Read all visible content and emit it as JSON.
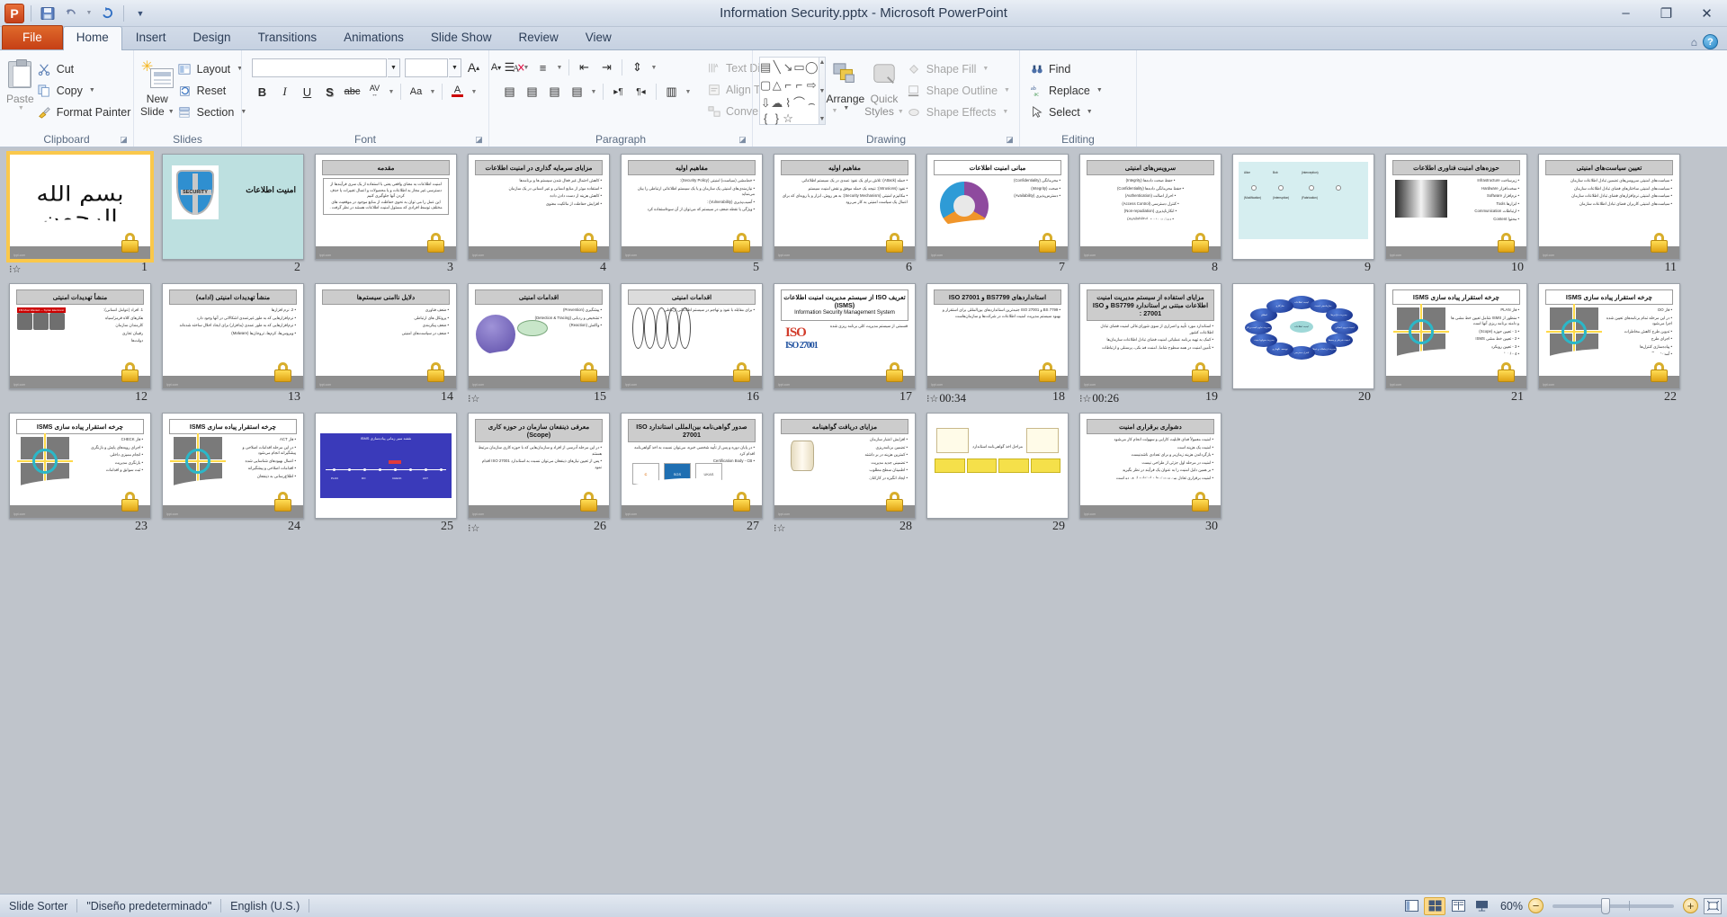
{
  "window": {
    "title": "Information Security.pptx  -  Microsoft PowerPoint",
    "minimize": "–",
    "restore": "❐",
    "close": "✕"
  },
  "qat": {
    "save": "save-icon",
    "undo": "undo-icon",
    "redo": "redo-icon",
    "customize": "customize-icon"
  },
  "tabs": [
    {
      "label": "File",
      "id": "file"
    },
    {
      "label": "Home",
      "id": "home"
    },
    {
      "label": "Insert",
      "id": "insert"
    },
    {
      "label": "Design",
      "id": "design"
    },
    {
      "label": "Transitions",
      "id": "transitions"
    },
    {
      "label": "Animations",
      "id": "animations"
    },
    {
      "label": "Slide Show",
      "id": "slideshow"
    },
    {
      "label": "Review",
      "id": "review"
    },
    {
      "label": "View",
      "id": "view"
    }
  ],
  "tab_active": "Home",
  "ribbon": {
    "clipboard": {
      "group_label": "Clipboard",
      "paste": "Paste",
      "cut": "Cut",
      "copy": "Copy",
      "format_painter": "Format Painter"
    },
    "slides": {
      "group_label": "Slides",
      "new_slide": "New",
      "new_slide2": "Slide",
      "layout": "Layout",
      "reset": "Reset",
      "section": "Section"
    },
    "font": {
      "group_label": "Font",
      "font_name": "",
      "font_size": "",
      "grow": "A",
      "shrink": "A",
      "clear_formatting": "clear-formatting-icon",
      "bold": "B",
      "italic": "I",
      "underline": "U",
      "shadow": "S",
      "strikethrough": "abc",
      "spacing": "AV",
      "case": "Aa",
      "color": "A"
    },
    "paragraph": {
      "group_label": "Paragraph",
      "text_direction": "Text Direction",
      "align_text": "Align Text",
      "convert_smartart": "Convert to SmartArt"
    },
    "drawing": {
      "group_label": "Drawing",
      "arrange": "Arrange",
      "quick_styles": "Quick",
      "quick_styles2": "Styles",
      "shape_fill": "Shape Fill",
      "shape_outline": "Shape Outline",
      "shape_effects": "Shape Effects",
      "shapes": [
        "▤",
        "╲",
        "↘",
        "▭",
        "◯",
        "▢",
        "△",
        "┐",
        "┘",
        "⇨",
        "⇩",
        "☁",
        "⌇",
        "⌒",
        "⌢",
        "{",
        "}",
        "☆"
      ]
    },
    "editing": {
      "group_label": "Editing",
      "find": "Find",
      "replace": "Replace",
      "select": "Select"
    }
  },
  "slides": [
    {
      "n": "1",
      "type": "bismillah",
      "title": "",
      "timing": "",
      "transition": true,
      "selected": true,
      "calligraphy": "بسم الله الرحمن الرحیم"
    },
    {
      "n": "2",
      "type": "teal",
      "title": "امنیت اطلاعات",
      "shield": "SECURITY",
      "timing": "",
      "transition": false
    },
    {
      "n": "3",
      "type": "textboxed",
      "title": "مقدمه",
      "timing": "",
      "transition": false,
      "lines": [
        "امنیت اطلاعات به معنای واقعی یعنی با استفاده از یک سری فرآیندها از دسترسی غیر مجاز به اطلاعات و یا محصولات و اعمال تغییرات یا حذف کردن آنها جلوگیری کنیم",
        "این عمل را می توان به نحوی حفاظت از منابع موجود در موقعیت های مختلف توسط افرادی که مسئول امنیت اطلاعات هستند در نظر گرفت ."
      ]
    },
    {
      "n": "4",
      "type": "bullets",
      "title": "مزایای سرمایه گذاری در امنیت اطلاعات",
      "timing": "",
      "transition": false,
      "lines": [
        "کاهش احتمال غیر فعال شدن سیستم ها و برنامه‌ها",
        "استفاده موثر از منابع انسانی و غیر انسانی در یک سازمان",
        "کاهش هزینه از دست دادن داده",
        "افزایش حفاظت از مالکیت معنوی"
      ]
    },
    {
      "n": "5",
      "type": "bullets",
      "title": "مفاهیم اولیه",
      "timing": "",
      "transition": false,
      "lines": [
        "خط‌مشی (سیاست) امنیتی (Security Policy):",
        "نیازمندی‌های امنیتی یک سازمان و یا یک سیستم اطلاعاتی ارتباطی را بیان می‌نماید",
        "آسیب‌پذیری (Vulnerability) :",
        "ویژگی یا نقطه ضعف در سیستم که می‌توان از آن سوءاستفاده کرد"
      ]
    },
    {
      "n": "6",
      "type": "bullets",
      "title": "مفاهیم اولیه",
      "timing": "",
      "transition": false,
      "lines": [
        "حمله (Attack): تلاش برای یک نفوذ عمدی در یک سیستم اطلاعاتی",
        "نفوذ (Intrusions): نتیجه یک حمله موفق و نقض امنیت سیستم",
        "مکانیزم امنیتی (Security Mechanism): به هر روش، ابزار و یا رویه‌ای که برای اعمال یک سیاست امنیتی به کار می‌رود"
      ]
    },
    {
      "n": "7",
      "type": "donut",
      "title": "مبانی امنیت اطلاعات",
      "timing": "",
      "transition": false,
      "lines": [
        "محرمانگی (Confidentiality)",
        "صحت (Integrity)",
        "دسترس‌پذیری (Availability)"
      ]
    },
    {
      "n": "8",
      "type": "bullets-center",
      "title": "سرویس‌های امنیتی",
      "timing": "",
      "transition": false,
      "lines": [
        "حفظ صحت داده‌ها (Integrity)",
        "حفظ محرمانگی داده‌ها (Confidentiality)",
        "احراز اصالت (Authentication)",
        "کنترل دسترسی (Access Control)",
        "انکارناپذیری (Non-repudiation)",
        "دسترس‌پذیری (Availability)"
      ]
    },
    {
      "n": "9",
      "type": "netdiag",
      "title": "",
      "timing": "",
      "transition": false,
      "lines": [
        "Alice",
        "Bob",
        "(interception)",
        "(Modification)",
        "(Interruption)",
        "(Fabrication)"
      ]
    },
    {
      "n": "10",
      "type": "server",
      "title": "حوزه‌های امنیت فناوری اطلاعات",
      "timing": "",
      "transition": false,
      "lines": [
        "زیرساخت Infrastructure",
        "سخت‌افزار Hardware",
        "نرم‌افزار Software",
        "ابزارها Tools",
        "ارتباطات Communication",
        "محتوا Content"
      ]
    },
    {
      "n": "11",
      "type": "bullets",
      "title": "تعیین سیاست‌های امنیتی",
      "timing": "",
      "transition": false,
      "lines": [
        "سیاست‌های امنیتی سرویس‌های تضمین تبادل اطلاعات سازمان",
        "سیاست‌های امنیتی ساختارهای فضای تبادل اطلاعات سازمان",
        "سیاست‌های امنیتی نرم‌افزارهای فضای تبادل اطلاعات سازمان",
        "سیاست‌های امنیتی کاربران فضای تبادل اطلاعات سازمان"
      ]
    },
    {
      "n": "12",
      "type": "photos",
      "title": "منشأ تهدیدات امنیتی",
      "timing": "",
      "transition": false,
      "banner": "FBI Most Wanted — Syrian Electronic Army",
      "lines": [
        "1. افراد (عوامل انسانی):",
        "هکرهای کلاه قرمز/سیاه",
        "کارمندان سازمان",
        "رقیبان تجاری",
        "دولت‌ها"
      ]
    },
    {
      "n": "13",
      "type": "bullets",
      "title": "منشأ تهدیدات امنیتی (ادامه)",
      "timing": "",
      "transition": false,
      "lines": [
        "2. نرم افزارها",
        "نرم‌افزارهایی که به طور غیرعمدی اشکالاتی در آنها وجود دارد",
        "نرم‌افزارهایی که به طور عمدی (بدافزار) برای ایجاد اخلال ساخته شده‌اند",
        "ویروس‌ها، کرم‌ها، تروجان‌ها (Malware)"
      ]
    },
    {
      "n": "14",
      "type": "bullets",
      "title": "دلایل ناامنی سیستم‌ها",
      "timing": "",
      "transition": false,
      "lines": [
        "ضعف فناوری",
        "پروتکل های ارتباطی",
        "ضعف پیکربندی",
        "ضعف در سیاست‌های امنیتی"
      ]
    },
    {
      "n": "15",
      "type": "cyclediag",
      "title": "اقدامات امنیتی",
      "timing": "",
      "transition": true,
      "lines": [
        "پیشگیری (Prevention)",
        "تشخیص و ردیابی (Detection & Tracing)",
        "واکنش (Reaction)"
      ]
    },
    {
      "n": "16",
      "type": "funnel",
      "title": "اقدامات امنیتی",
      "timing": "",
      "transition": false,
      "lines": [
        "برای مقابله با نفوذ و تهاجم در سیستم اطلاعاتی ارتباطی"
      ]
    },
    {
      "n": "17",
      "type": "iso",
      "title": "تعریف ISO از سیستم مدیریت امنیت اطلاعات (ISMS)",
      "subtitle": "Information  Security  Management  System",
      "timing": "",
      "transition": false,
      "lines": [
        "قسمتی از سیستم مدیریت کلی برنامه ریزی شده",
        "ISO 27001"
      ]
    },
    {
      "n": "18",
      "type": "bullets",
      "title": "استانداردهای BS7799 و ISO 27001",
      "timing": "00:34",
      "transition": true,
      "lines": [
        "BS 7799 و ISO 27001 جنبه‌ترین استانداردهای بین‌المللی برای استقرار و بهبود سیستم مدیریت امنیت اطلاعات در شرکت‌ها و سازمان‌هاست"
      ]
    },
    {
      "n": "19",
      "type": "bullets",
      "title": "مزایای استفاده از سیستم مدیریت امنیت اطلاعات مبتنی بر استاندارد BS7799 و ISO 27001 :",
      "timing": "00:26",
      "transition": true,
      "lines": [
        "استاندارد مورد تأیید و اصراری از سوی شورای‌عالی امنیت فضای تبادل اطلاعات کشور",
        "کمک به تهیه برنامه عملیاتی امنیت فضای تبادل اطلاعات سازمان‌ها",
        "تأمین امنیت در همه سطوح شامل امنیت فیزیکی، پرسنلی و ارتباطات"
      ]
    },
    {
      "n": "20",
      "type": "bluediag",
      "title": "",
      "timing": "",
      "transition": false,
      "lines": [
        "امنیت اطلاعات",
        "سازماندهی امنیت",
        "مدیریت دارایی‌ها",
        "امنیت نیروی انسانی",
        "امنیت فیزیکی و محیط",
        "مدیریت ارتباطات و عملیات",
        "کنترل دسترسی",
        "توسعه، نگهداری",
        "مدیریت سوانح امنیت",
        "مدیریت تداوم کسب و کار",
        "انطباق",
        "سازگاری"
      ]
    },
    {
      "n": "21",
      "type": "pdca",
      "title": "چرخه استقرار پیاده سازی ISMS",
      "timing": "",
      "transition": false,
      "lines": [
        "فاز PLAN",
        "منظور از ISMS شامل تعیین خط مشی ها و دامنه برنامه ریزی آنها است",
        "1 - تعیین حوزه (Scope)",
        "2 - تعیین خط مشی ISMS",
        "3 - تعیین رویکرد",
        "4 - ارزیابی ریسک",
        "5 - انتخاب کنترل‌های مناسب"
      ]
    },
    {
      "n": "22",
      "type": "pdca",
      "title": "چرخه استقرار پیاده سازی ISMS",
      "timing": "",
      "transition": false,
      "lines": [
        "فاز DO",
        "در این مرحله تمام برنامه‌های تعیین شده اجرا می‌شود",
        "تدوین طرح کاهش مخاطرات",
        "اجرای طرح",
        "پیاده‌سازی کنترل‌ها",
        "آموزش و آگاهی‌رسانی",
        "مدیریت عملیات"
      ]
    },
    {
      "n": "23",
      "type": "pdca",
      "title": "چرخه استقرار پیاده سازی ISMS",
      "timing": "",
      "transition": false,
      "lines": [
        "فاز CHECK",
        "اجرای رویه‌های پایش و بازنگری",
        "انجام ممیزی داخلی",
        "بازنگری مدیریت",
        "ثبت سوابق و اقدامات"
      ]
    },
    {
      "n": "24",
      "type": "pdca",
      "title": "چرخه استقرار پیاده سازی ISMS",
      "timing": "",
      "transition": false,
      "lines": [
        "فاز ACT",
        "در این مرحله اقدامات اصلاحی و پیشگیرانه انجام می‌شود",
        "اعمال بهبودهای شناسایی شده",
        "اقدامات اصلاحی و پیشگیرانه",
        "اطلاع‌رسانی به ذینفعان"
      ]
    },
    {
      "n": "25",
      "type": "blueline",
      "title": "نقشه سیر زمانی پیاده‌سازی ISMS",
      "timing": "",
      "transition": false,
      "lines": [
        "PLAN",
        "DO",
        "CHECK",
        "ACT"
      ]
    },
    {
      "n": "26",
      "type": "bullets",
      "title": "معرفی ذینفعان سازمان در حوزه کاری (Scope)",
      "timing": "",
      "transition": true,
      "lines": [
        "در این مرحله آدرسی از افراد و سازمان‌هایی که با حوزه کاری سازمان مرتبط هستند",
        "پس از تعیین نیازهای ذینفعان می‌توان نسبت به استاندارد ISO 27001 اقدام نمود"
      ]
    },
    {
      "n": "27",
      "type": "certs",
      "title": "صدور گواهی‌نامه بین‌المللی استاندارد ISO 27001",
      "timing": "",
      "transition": false,
      "lines": [
        "در پایان دوره و پس از تأیید شخصی خبره، می‌توان نسبت به اخذ گواهی‌نامه اقدام کرد",
        "Certification Body - CB"
      ]
    },
    {
      "n": "28",
      "type": "cylinder",
      "title": "مزایای دریافت گواهینامه",
      "timing": "",
      "transition": true,
      "lines": [
        "افزایش اعتبار سازمان",
        "تضمین برنامه‌ریزی",
        "کمترین هزینه در بر داشته",
        "تضمینی جدید مدیریت",
        "اطمینان سطح مطلوب",
        "ایجاد انگیزه در کارکنان"
      ]
    },
    {
      "n": "29",
      "type": "flowchart",
      "title": "",
      "timing": "",
      "transition": false,
      "lines": [
        "مراحل اخذ گواهی‌نامه استاندارد"
      ]
    },
    {
      "n": "30",
      "type": "bullets",
      "title": "دشواری برقراری امنیت",
      "timing": "",
      "transition": false,
      "lines": [
        "امنیت معمولاً فدای قابلیت کارایی و سهولت انجام کار می‌شود",
        "امنیت یک هزینه است",
        "بازگرداندن هزینه زمان‌بر و برای تعدادی ناشدنیست",
        "امنیت در مرحله اول جزئی از طراحی نیست",
        "بر همین دلیل امنیت را به عنوان یک فرآیند در نظر بگیرید",
        "امنیت برقراری تعادل بین سیستم‌ها و استفاده از هر دو است"
      ]
    }
  ],
  "status": {
    "view_mode": "Slide Sorter",
    "theme": "\"Diseño predeterminado\"",
    "language": "English (U.S.)",
    "zoom_percent": "60%",
    "views": [
      {
        "name": "normal-view",
        "glyph": "▥"
      },
      {
        "name": "slide-sorter-view",
        "glyph": "▦",
        "active": true
      },
      {
        "name": "reading-view",
        "glyph": "▤"
      },
      {
        "name": "slide-show-view",
        "glyph": "▣"
      }
    ],
    "zoom_out": "−",
    "zoom_in": "+",
    "fit_to_window": "fit-to-window-icon"
  }
}
